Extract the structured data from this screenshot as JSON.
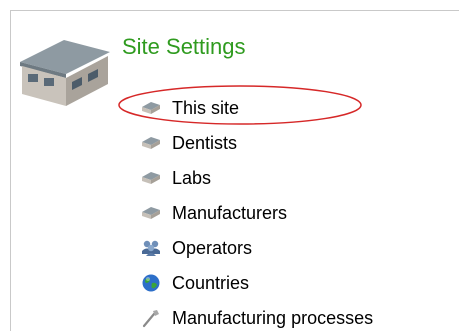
{
  "header": {
    "title": "Site Settings",
    "icon": "building-icon"
  },
  "items": [
    {
      "label": "This site",
      "icon": "site-icon"
    },
    {
      "label": "Dentists",
      "icon": "site-icon"
    },
    {
      "label": "Labs",
      "icon": "site-icon"
    },
    {
      "label": "Manufacturers",
      "icon": "site-icon"
    },
    {
      "label": "Operators",
      "icon": "users-icon"
    },
    {
      "label": "Countries",
      "icon": "globe-icon"
    },
    {
      "label": "Manufacturing processes",
      "icon": "tool-icon"
    }
  ],
  "highlight": {
    "target": "This site",
    "color": "#d62828"
  },
  "colors": {
    "title": "#2f9b1f",
    "text": "#000000",
    "border": "#c9c9c9"
  }
}
